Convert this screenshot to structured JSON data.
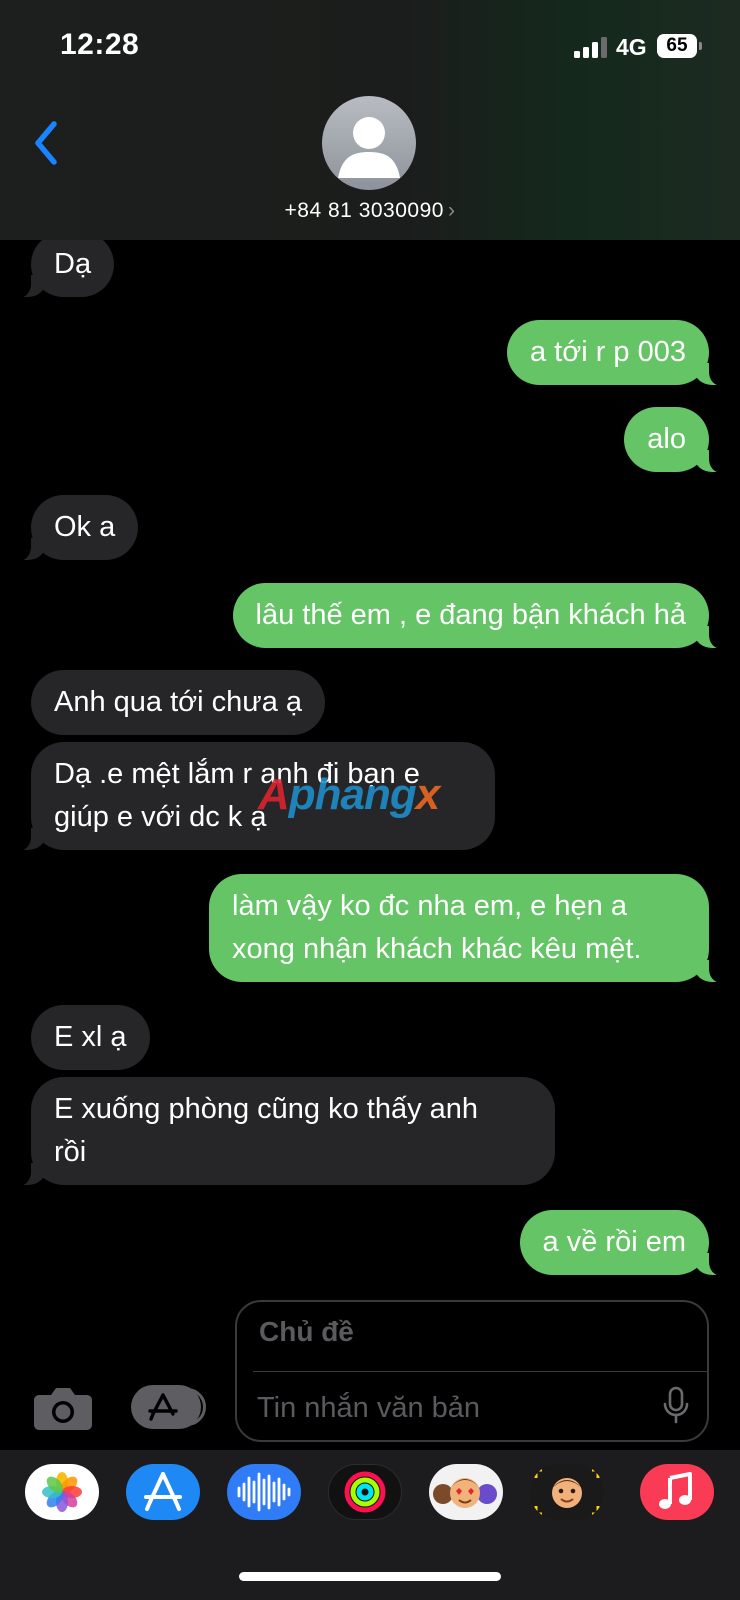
{
  "status_bar": {
    "time": "12:28",
    "network": "4G",
    "battery": "65"
  },
  "header": {
    "contact_number": "+84 81 3030090",
    "chevron": "›"
  },
  "messages": [
    {
      "direction": "incoming",
      "text": "Dạ"
    },
    {
      "direction": "outgoing",
      "text": "a tới r p 003"
    },
    {
      "direction": "outgoing",
      "text": "alo"
    },
    {
      "direction": "incoming",
      "text": "Ok a"
    },
    {
      "direction": "outgoing",
      "text": "lâu thế em , e đang bận khách hả"
    },
    {
      "direction": "incoming",
      "text": "Anh qua tới chưa ạ"
    },
    {
      "direction": "incoming",
      "line1": "Dạ .e mệt lắm r anh đi bạn e",
      "line2": "giúp e với dc k ạ"
    },
    {
      "direction": "outgoing",
      "line1": "làm vậy ko đc nha em, e hẹn a",
      "line2": "xong nhận khách khác kêu mệt."
    },
    {
      "direction": "incoming",
      "text": "E xl ạ"
    },
    {
      "direction": "incoming",
      "line1": "E xuống phòng cũng ko thấy anh",
      "line2": "rồi"
    },
    {
      "direction": "outgoing",
      "text": "a về rồi em"
    }
  ],
  "watermark": {
    "part1": "A",
    "part2": "phang",
    "part3": "x"
  },
  "compose": {
    "subject_placeholder": "Chủ đề",
    "text_placeholder": "Tin nhắn văn bản"
  },
  "icons": {
    "back": "chevron-left-icon",
    "camera": "camera-icon",
    "apps": "app-store-icon",
    "mic": "microphone-icon",
    "app_strip": [
      "photos-icon",
      "app-store-icon",
      "audio-waveform-icon",
      "activity-rings-icon",
      "memoji-stickers-icon",
      "memoji-icon",
      "music-icon"
    ]
  },
  "colors": {
    "outgoing_bubble": "#65c466",
    "incoming_bubble": "#262628",
    "accent_blue": "#1a84ff"
  }
}
